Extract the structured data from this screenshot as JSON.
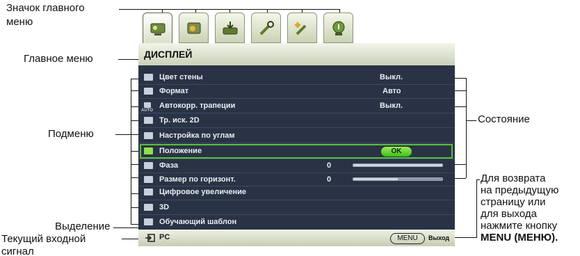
{
  "callouts": {
    "main_menu_icon": [
      "Значок главного",
      "меню"
    ],
    "main_menu": "Главное меню",
    "submenu": "Подменю",
    "highlight": "Выделение",
    "current_input": [
      "Текущий входной",
      "сигнал"
    ],
    "status": "Состояние",
    "back_hint": [
      "Для возврата",
      "на предыдущую",
      "страницу или",
      "для выхода",
      "нажмите кнопку",
      "MENU (МЕНЮ)."
    ]
  },
  "tabs": [
    {
      "icon": "display-icon",
      "active": true
    },
    {
      "icon": "picture-icon",
      "active": false
    },
    {
      "icon": "source-icon",
      "active": false
    },
    {
      "icon": "system-setup-basic-icon",
      "active": false
    },
    {
      "icon": "system-setup-advanced-icon",
      "active": false
    },
    {
      "icon": "information-icon",
      "active": false
    }
  ],
  "menu": {
    "title": "ДИСПЛЕЙ",
    "items": [
      {
        "label": "Цвет стены",
        "value": "Выкл."
      },
      {
        "label": "Формат",
        "value": "Авто"
      },
      {
        "label": "Автокорр. трапеции",
        "value": "Выкл."
      },
      {
        "label": "Тр. иск. 2D",
        "value": ""
      },
      {
        "label": "Настройка по углам",
        "value": ""
      },
      {
        "label": "Положение",
        "value": "OK"
      },
      {
        "label": "Фаза",
        "value": "0"
      },
      {
        "label": "Размер по горизонт.",
        "value": "0"
      },
      {
        "label": "Цифровое увеличение",
        "value": ""
      },
      {
        "label": "3D",
        "value": ""
      },
      {
        "label": "Обучающий шаблон",
        "value": ""
      }
    ],
    "auto_badge": "AUTO"
  },
  "bottom": {
    "input": "PC",
    "menu_key": "MENU",
    "exit": "Выход"
  },
  "colors": {
    "panel_bg": "#2a3346",
    "highlight": "#57c23b",
    "ok_button": "#3bbf1a"
  }
}
